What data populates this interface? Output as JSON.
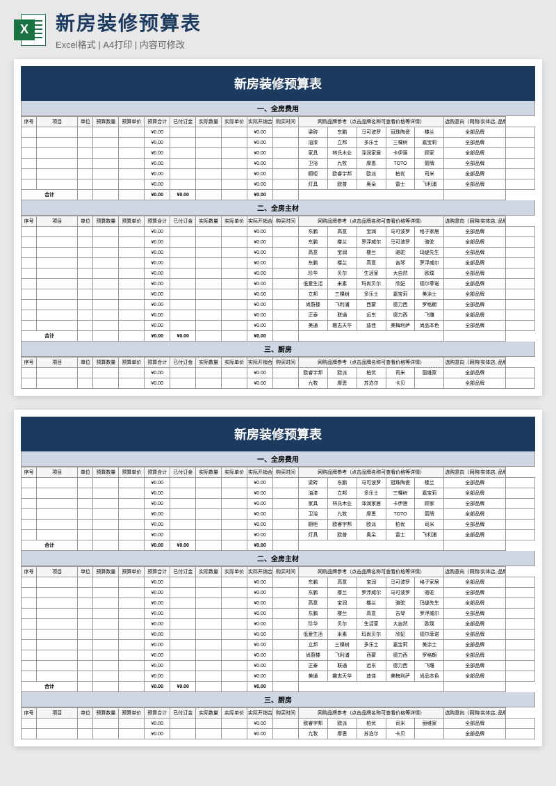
{
  "header": {
    "icon_letter": "X",
    "title": "新房装修预算表",
    "subtitle": "Excel格式 | A4打印 | 内容可修改"
  },
  "doc": {
    "title": "新房装修预算表",
    "zero": "¥0.00",
    "columns": {
      "seq": "序号",
      "item": "项目",
      "unit": "单位",
      "budget_qty": "预算数量",
      "budget_price": "预算单价",
      "budget_total": "预算合计",
      "deposit": "已付订金",
      "actual_qty": "实际数量",
      "actual_price": "实际单价",
      "actual_total": "实际开销合计",
      "buy_time": "购买时间",
      "brand_ref": "网购品牌参考（点击品牌名称可查看价格等详情）",
      "selection": "选购意向（网购/实体店, 品牌, 型号等）"
    },
    "sum_label": "合计",
    "sections": [
      {
        "title": "一、全房费用",
        "rows": [
          {
            "cat": "梁砖",
            "brands": [
              "东鹏",
              "马可波罗",
              "冠珠陶瓷",
              "楼兰",
              "全部品牌"
            ]
          },
          {
            "cat": "油漆",
            "brands": [
              "立邦",
              "多乐士",
              "三棵树",
              "嘉宝莉",
              "全部品牌"
            ]
          },
          {
            "cat": "家具",
            "brands": [
              "林氏木业",
              "泽润家居",
              "卡伊莲",
              "顾家",
              "全部品牌"
            ]
          },
          {
            "cat": "卫浴",
            "brands": [
              "九牧",
              "摩恩",
              "TOTO",
              "箭牌",
              "全部品牌"
            ]
          },
          {
            "cat": "橱柜",
            "brands": [
              "欧睿宇邦",
              "欧派",
              "柏优",
              "司米",
              "全部品牌"
            ]
          },
          {
            "cat": "灯具",
            "brands": [
              "欧普",
              "奥朵",
              "雷士",
              "飞利浦",
              "全部品牌"
            ]
          }
        ],
        "has_sum": true
      },
      {
        "title": "二、全房主材",
        "rows": [
          {
            "cat": "东鹏",
            "brands": [
              "高意",
              "宝润",
              "马可波罗",
              "格子家居",
              "全部品牌"
            ]
          },
          {
            "cat": "东鹏",
            "brands": [
              "楼兰",
              "罗浮威尔",
              "马可波罗",
              "骆驼",
              "全部品牌"
            ]
          },
          {
            "cat": "高意",
            "brands": [
              "宝润",
              "楼兰",
              "骆驼",
              "玛缇先生",
              "全部品牌"
            ]
          },
          {
            "cat": "东鹏",
            "brands": [
              "楼兰",
              "高意",
              "吉琴",
              "罗浮威尔",
              "全部品牌"
            ]
          },
          {
            "cat": "珍华",
            "brands": [
              "贝尔",
              "生活家",
              "大自然",
              "欧璞",
              "全部品牌"
            ]
          },
          {
            "cat": "低爱生活",
            "brands": [
              "米素",
              "玛尚贝尔",
              "欣妃",
              "德尔菲诺",
              "全部品牌"
            ]
          },
          {
            "cat": "立邦",
            "brands": [
              "三棵树",
              "多乐士",
              "嘉宝莉",
              "美涂士",
              "全部品牌"
            ]
          },
          {
            "cat": "尚蔚楼",
            "brands": [
              "飞利浦",
              "西蒙",
              "德力西",
              "罗格朗",
              "全部品牌"
            ]
          },
          {
            "cat": "正泰",
            "brands": [
              "联通",
              "远东",
              "德力西",
              "飞雕",
              "全部品牌"
            ]
          },
          {
            "cat": "美通",
            "brands": [
              "趣志天华",
              "迪佳",
              "美梅利萨",
              "尚品本色",
              "全部品牌"
            ]
          }
        ],
        "has_sum": true
      },
      {
        "title": "三、厨房",
        "rows": [
          {
            "cat": "欧睿宇邦",
            "brands": [
              "欧派",
              "柏优",
              "司米",
              "丽维家",
              "全部品牌"
            ]
          },
          {
            "cat": "九牧",
            "brands": [
              "摩恩",
              "苏泊尔",
              "卡贝",
              "",
              "全部品牌"
            ]
          }
        ],
        "has_sum": false
      }
    ]
  }
}
